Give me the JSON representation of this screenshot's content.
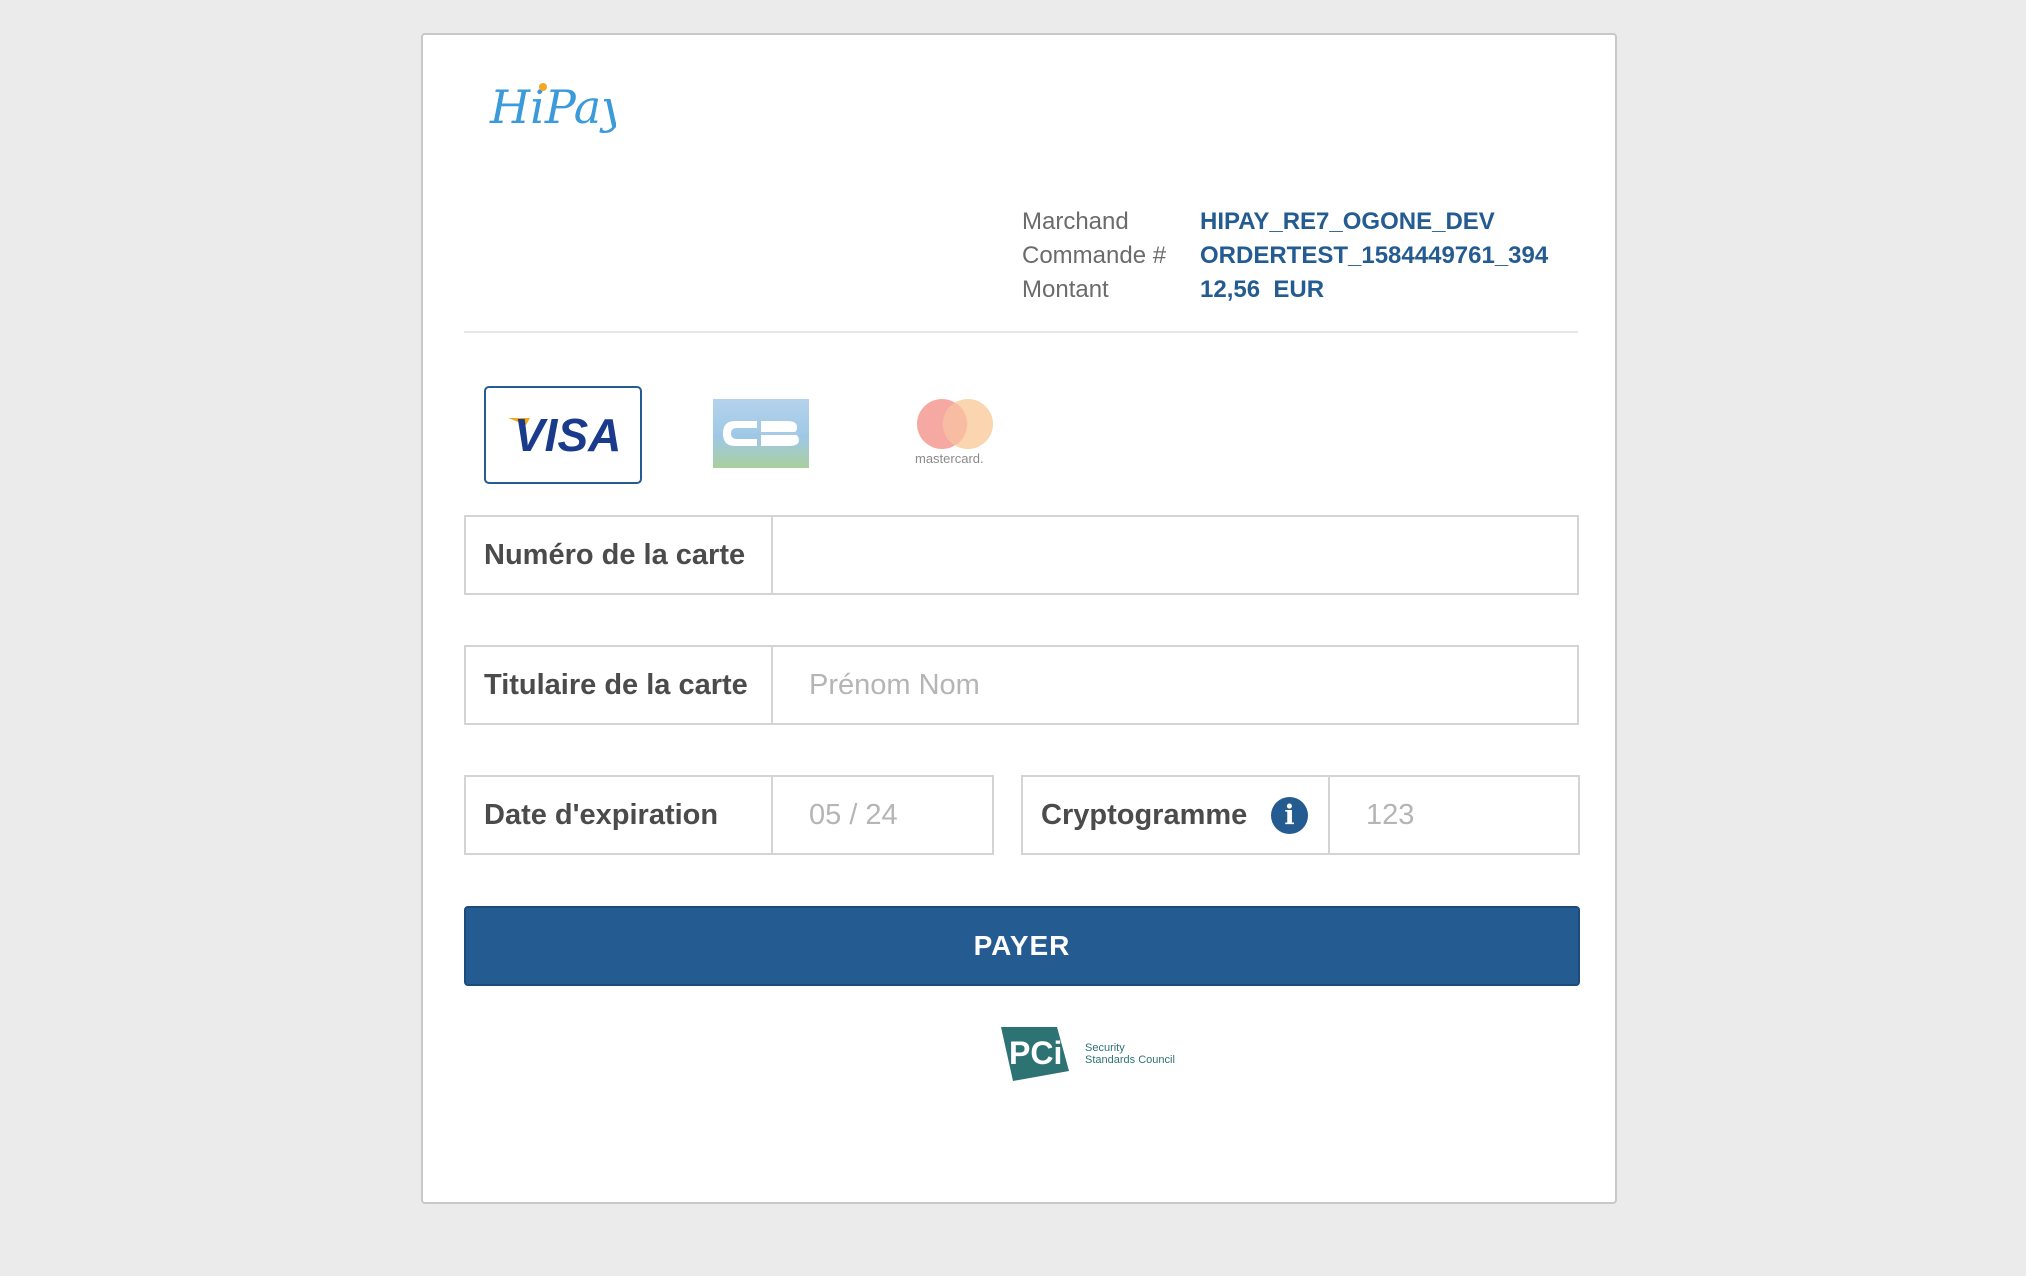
{
  "brand": {
    "logo_text": "HiPay"
  },
  "order": {
    "merchant_label": "Marchand",
    "merchant_value": "HIPAY_RE7_OGONE_DEV",
    "order_label": "Commande #",
    "order_value": "ORDERTEST_1584449761_394",
    "amount_label": "Montant",
    "amount_value": "12,56  EUR"
  },
  "card_brands": [
    {
      "name": "visa",
      "label": "VISA",
      "selected": true
    },
    {
      "name": "cb",
      "label": "CB",
      "selected": false
    },
    {
      "name": "mastercard",
      "label": "mastercard.",
      "selected": false
    }
  ],
  "form": {
    "card_number_label": "Numéro de la carte",
    "card_number_value": "",
    "card_holder_label": "Titulaire de la carte",
    "card_holder_placeholder": "Prénom Nom",
    "expiry_label": "Date d'expiration",
    "expiry_placeholder": "05 / 24",
    "cvv_label": "Cryptogramme",
    "cvv_info_icon": "i",
    "cvv_placeholder": "123",
    "pay_label": "PAYER"
  },
  "footer": {
    "pci_mark": "PCi",
    "pci_text_line1": "Security",
    "pci_text_line2": "Standards Council"
  },
  "colors": {
    "primary": "#245b91",
    "logo_blue": "#3b9ad9",
    "logo_dot": "#f5a623",
    "pci_green": "#2e7373",
    "background": "#ebebeb"
  }
}
